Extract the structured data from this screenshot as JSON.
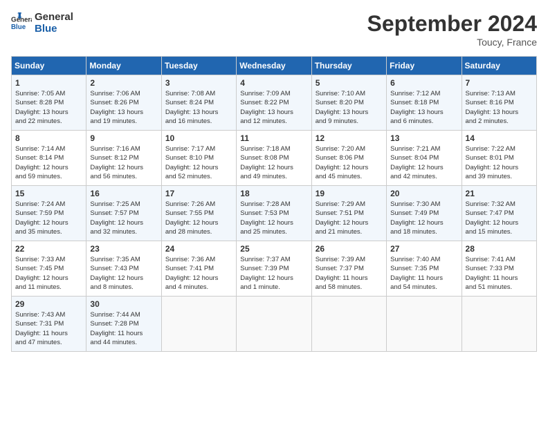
{
  "header": {
    "logo_line1": "General",
    "logo_line2": "Blue",
    "title": "September 2024",
    "location": "Toucy, France"
  },
  "days_of_week": [
    "Sunday",
    "Monday",
    "Tuesday",
    "Wednesday",
    "Thursday",
    "Friday",
    "Saturday"
  ],
  "weeks": [
    [
      {
        "day": "1",
        "lines": [
          "Sunrise: 7:05 AM",
          "Sunset: 8:28 PM",
          "Daylight: 13 hours",
          "and 22 minutes."
        ]
      },
      {
        "day": "2",
        "lines": [
          "Sunrise: 7:06 AM",
          "Sunset: 8:26 PM",
          "Daylight: 13 hours",
          "and 19 minutes."
        ]
      },
      {
        "day": "3",
        "lines": [
          "Sunrise: 7:08 AM",
          "Sunset: 8:24 PM",
          "Daylight: 13 hours",
          "and 16 minutes."
        ]
      },
      {
        "day": "4",
        "lines": [
          "Sunrise: 7:09 AM",
          "Sunset: 8:22 PM",
          "Daylight: 13 hours",
          "and 12 minutes."
        ]
      },
      {
        "day": "5",
        "lines": [
          "Sunrise: 7:10 AM",
          "Sunset: 8:20 PM",
          "Daylight: 13 hours",
          "and 9 minutes."
        ]
      },
      {
        "day": "6",
        "lines": [
          "Sunrise: 7:12 AM",
          "Sunset: 8:18 PM",
          "Daylight: 13 hours",
          "and 6 minutes."
        ]
      },
      {
        "day": "7",
        "lines": [
          "Sunrise: 7:13 AM",
          "Sunset: 8:16 PM",
          "Daylight: 13 hours",
          "and 2 minutes."
        ]
      }
    ],
    [
      {
        "day": "8",
        "lines": [
          "Sunrise: 7:14 AM",
          "Sunset: 8:14 PM",
          "Daylight: 12 hours",
          "and 59 minutes."
        ]
      },
      {
        "day": "9",
        "lines": [
          "Sunrise: 7:16 AM",
          "Sunset: 8:12 PM",
          "Daylight: 12 hours",
          "and 56 minutes."
        ]
      },
      {
        "day": "10",
        "lines": [
          "Sunrise: 7:17 AM",
          "Sunset: 8:10 PM",
          "Daylight: 12 hours",
          "and 52 minutes."
        ]
      },
      {
        "day": "11",
        "lines": [
          "Sunrise: 7:18 AM",
          "Sunset: 8:08 PM",
          "Daylight: 12 hours",
          "and 49 minutes."
        ]
      },
      {
        "day": "12",
        "lines": [
          "Sunrise: 7:20 AM",
          "Sunset: 8:06 PM",
          "Daylight: 12 hours",
          "and 45 minutes."
        ]
      },
      {
        "day": "13",
        "lines": [
          "Sunrise: 7:21 AM",
          "Sunset: 8:04 PM",
          "Daylight: 12 hours",
          "and 42 minutes."
        ]
      },
      {
        "day": "14",
        "lines": [
          "Sunrise: 7:22 AM",
          "Sunset: 8:01 PM",
          "Daylight: 12 hours",
          "and 39 minutes."
        ]
      }
    ],
    [
      {
        "day": "15",
        "lines": [
          "Sunrise: 7:24 AM",
          "Sunset: 7:59 PM",
          "Daylight: 12 hours",
          "and 35 minutes."
        ]
      },
      {
        "day": "16",
        "lines": [
          "Sunrise: 7:25 AM",
          "Sunset: 7:57 PM",
          "Daylight: 12 hours",
          "and 32 minutes."
        ]
      },
      {
        "day": "17",
        "lines": [
          "Sunrise: 7:26 AM",
          "Sunset: 7:55 PM",
          "Daylight: 12 hours",
          "and 28 minutes."
        ]
      },
      {
        "day": "18",
        "lines": [
          "Sunrise: 7:28 AM",
          "Sunset: 7:53 PM",
          "Daylight: 12 hours",
          "and 25 minutes."
        ]
      },
      {
        "day": "19",
        "lines": [
          "Sunrise: 7:29 AM",
          "Sunset: 7:51 PM",
          "Daylight: 12 hours",
          "and 21 minutes."
        ]
      },
      {
        "day": "20",
        "lines": [
          "Sunrise: 7:30 AM",
          "Sunset: 7:49 PM",
          "Daylight: 12 hours",
          "and 18 minutes."
        ]
      },
      {
        "day": "21",
        "lines": [
          "Sunrise: 7:32 AM",
          "Sunset: 7:47 PM",
          "Daylight: 12 hours",
          "and 15 minutes."
        ]
      }
    ],
    [
      {
        "day": "22",
        "lines": [
          "Sunrise: 7:33 AM",
          "Sunset: 7:45 PM",
          "Daylight: 12 hours",
          "and 11 minutes."
        ]
      },
      {
        "day": "23",
        "lines": [
          "Sunrise: 7:35 AM",
          "Sunset: 7:43 PM",
          "Daylight: 12 hours",
          "and 8 minutes."
        ]
      },
      {
        "day": "24",
        "lines": [
          "Sunrise: 7:36 AM",
          "Sunset: 7:41 PM",
          "Daylight: 12 hours",
          "and 4 minutes."
        ]
      },
      {
        "day": "25",
        "lines": [
          "Sunrise: 7:37 AM",
          "Sunset: 7:39 PM",
          "Daylight: 12 hours",
          "and 1 minute."
        ]
      },
      {
        "day": "26",
        "lines": [
          "Sunrise: 7:39 AM",
          "Sunset: 7:37 PM",
          "Daylight: 11 hours",
          "and 58 minutes."
        ]
      },
      {
        "day": "27",
        "lines": [
          "Sunrise: 7:40 AM",
          "Sunset: 7:35 PM",
          "Daylight: 11 hours",
          "and 54 minutes."
        ]
      },
      {
        "day": "28",
        "lines": [
          "Sunrise: 7:41 AM",
          "Sunset: 7:33 PM",
          "Daylight: 11 hours",
          "and 51 minutes."
        ]
      }
    ],
    [
      {
        "day": "29",
        "lines": [
          "Sunrise: 7:43 AM",
          "Sunset: 7:31 PM",
          "Daylight: 11 hours",
          "and 47 minutes."
        ]
      },
      {
        "day": "30",
        "lines": [
          "Sunrise: 7:44 AM",
          "Sunset: 7:28 PM",
          "Daylight: 11 hours",
          "and 44 minutes."
        ]
      },
      {
        "day": "",
        "lines": []
      },
      {
        "day": "",
        "lines": []
      },
      {
        "day": "",
        "lines": []
      },
      {
        "day": "",
        "lines": []
      },
      {
        "day": "",
        "lines": []
      }
    ]
  ]
}
